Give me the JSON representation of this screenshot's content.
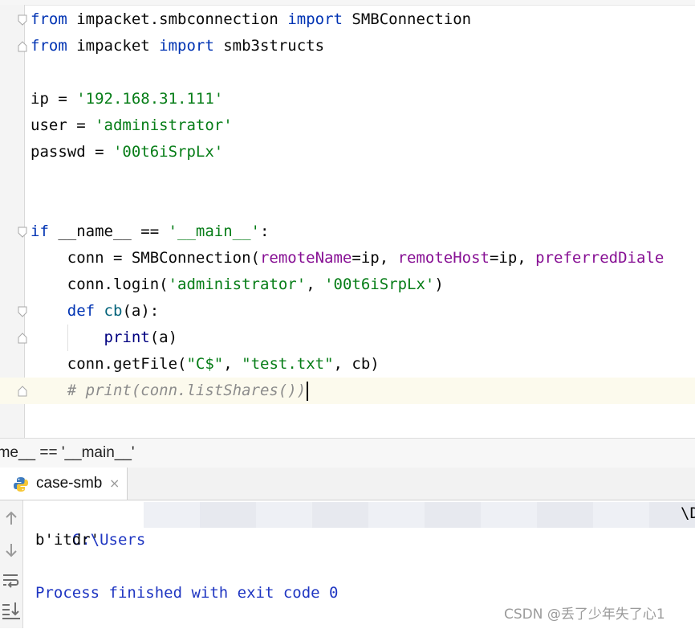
{
  "editor": {
    "lines": [
      {
        "id": "l1",
        "tokens": [
          {
            "t": "from",
            "c": "kw"
          },
          {
            "t": " impacket.smbconnection ",
            "c": ""
          },
          {
            "t": "import",
            "c": "kw"
          },
          {
            "t": " SMBConnection",
            "c": ""
          }
        ]
      },
      {
        "id": "l2",
        "tokens": [
          {
            "t": "from",
            "c": "kw"
          },
          {
            "t": " impacket ",
            "c": ""
          },
          {
            "t": "import",
            "c": "kw"
          },
          {
            "t": " smb3structs",
            "c": ""
          }
        ]
      },
      {
        "id": "l3",
        "tokens": []
      },
      {
        "id": "l4",
        "tokens": [
          {
            "t": "ip = ",
            "c": ""
          },
          {
            "t": "'192.168.31.111'",
            "c": "str"
          }
        ]
      },
      {
        "id": "l5",
        "tokens": [
          {
            "t": "user = ",
            "c": ""
          },
          {
            "t": "'administrator'",
            "c": "str"
          }
        ]
      },
      {
        "id": "l6",
        "tokens": [
          {
            "t": "passwd = ",
            "c": ""
          },
          {
            "t": "'00t6iSrpLx'",
            "c": "str"
          }
        ]
      },
      {
        "id": "l7",
        "tokens": []
      },
      {
        "id": "l8",
        "tokens": []
      },
      {
        "id": "l9",
        "tokens": [
          {
            "t": "if",
            "c": "kw"
          },
          {
            "t": " __name__ == ",
            "c": ""
          },
          {
            "t": "'__main__'",
            "c": "str"
          },
          {
            "t": ":",
            "c": ""
          }
        ]
      },
      {
        "id": "l10",
        "tokens": [
          {
            "t": "    conn = SMBConnection(",
            "c": ""
          },
          {
            "t": "remoteName",
            "c": "param"
          },
          {
            "t": "=ip, ",
            "c": ""
          },
          {
            "t": "remoteHost",
            "c": "param"
          },
          {
            "t": "=ip, ",
            "c": ""
          },
          {
            "t": "preferredDiale",
            "c": "param"
          }
        ]
      },
      {
        "id": "l11",
        "tokens": [
          {
            "t": "    conn.login(",
            "c": ""
          },
          {
            "t": "'administrator'",
            "c": "str"
          },
          {
            "t": ", ",
            "c": ""
          },
          {
            "t": "'00t6iSrpLx'",
            "c": "str"
          },
          {
            "t": ")",
            "c": ""
          }
        ]
      },
      {
        "id": "l12",
        "tokens": [
          {
            "t": "    ",
            "c": ""
          },
          {
            "t": "def",
            "c": "kw"
          },
          {
            "t": " ",
            "c": ""
          },
          {
            "t": "cb",
            "c": "fn"
          },
          {
            "t": "(a):",
            "c": ""
          }
        ]
      },
      {
        "id": "l13",
        "tokens": [
          {
            "t": "        ",
            "c": ""
          },
          {
            "t": "print",
            "c": "builtin"
          },
          {
            "t": "(a)",
            "c": ""
          }
        ]
      },
      {
        "id": "l14",
        "tokens": [
          {
            "t": "    conn.getFile(",
            "c": ""
          },
          {
            "t": "\"C$\"",
            "c": "str"
          },
          {
            "t": ", ",
            "c": ""
          },
          {
            "t": "\"test.txt\"",
            "c": "str"
          },
          {
            "t": ", cb)",
            "c": ""
          }
        ]
      },
      {
        "id": "l15",
        "tokens": [
          {
            "t": "    ",
            "c": ""
          },
          {
            "t": "# print(conn.listShares())",
            "c": "comment"
          }
        ]
      }
    ]
  },
  "breadcrumb": {
    "text": "ame__ == '__main__'"
  },
  "run_panel": {
    "tab_label": "case-smb",
    "close_glyph": "×",
    "console": {
      "path_prefix": "C:\\Users",
      "path_tail": "\\D",
      "output": "b'itdr'",
      "exit_message": "Process finished with exit code 0"
    }
  },
  "watermark": "CSDN @丢了少年失了心1",
  "colors": {
    "keyword": "#0033b3",
    "string": "#067d17",
    "parameter": "#871094",
    "comment": "#8c8c8c",
    "console_text": "#1f36c2"
  }
}
